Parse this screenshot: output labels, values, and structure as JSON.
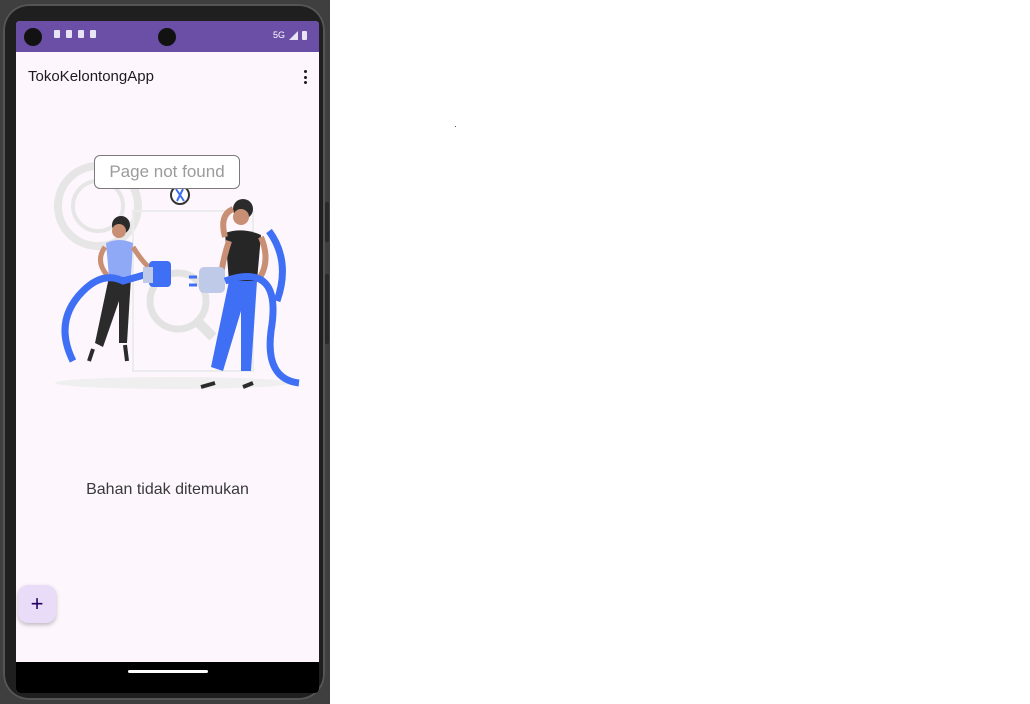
{
  "app": {
    "title": "TokoKelontongApp",
    "accent_color": "#6b4ea5",
    "background_color": "#fdf7fd"
  },
  "status_bar": {
    "left_icons": [
      "wifi-calling-icon",
      "shield-icon",
      "sim-icon",
      "sync-icon"
    ],
    "right_icons": [
      "signal-icon",
      "battery-icon"
    ],
    "network_label": "5G"
  },
  "toolbar": {
    "overflow_icon": "more-vert-icon"
  },
  "illustration": {
    "callout_text": "Page not found",
    "primary_color": "#3f6ff5"
  },
  "content": {
    "empty_message": "Bahan tidak ditemukan"
  },
  "fab": {
    "icon": "plus-icon",
    "label": "+"
  }
}
